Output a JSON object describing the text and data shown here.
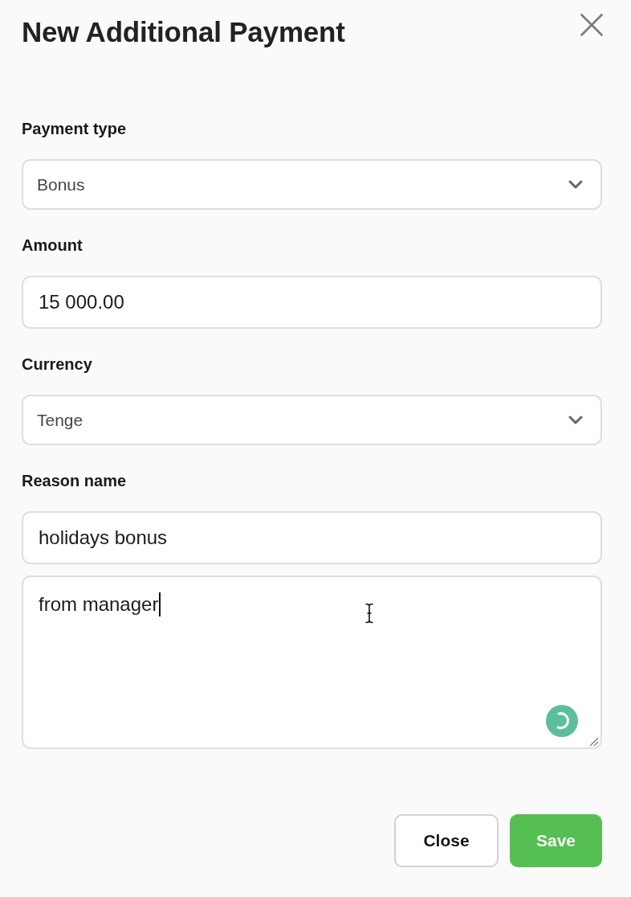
{
  "dialog": {
    "title": "New Additional Payment"
  },
  "fields": [
    {
      "kind": "select",
      "label": "Payment type",
      "value": "Bonus",
      "focused": false
    },
    {
      "kind": "input",
      "label": "Amount",
      "value": "15 000.00",
      "focused": false
    },
    {
      "kind": "select",
      "label": "Currency",
      "value": "Tenge",
      "focused": false
    },
    {
      "kind": "input",
      "label": "Reason name",
      "value": "holidays bonus",
      "focused": false
    },
    {
      "kind": "textarea",
      "value": "from manager",
      "focused": true
    }
  ],
  "buttons": [
    {
      "kind": "secondary",
      "label": "Close"
    },
    {
      "kind": "primary",
      "label": "Save"
    }
  ]
}
